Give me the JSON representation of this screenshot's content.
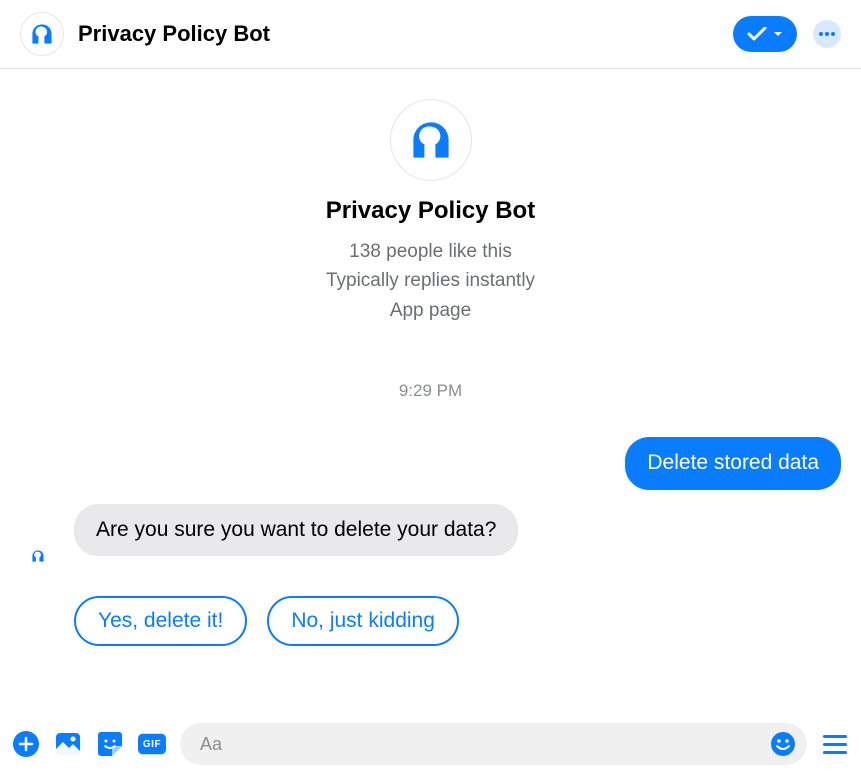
{
  "header": {
    "title": "Privacy Policy Bot"
  },
  "profile": {
    "name": "Privacy Policy Bot",
    "likes": "138 people like this",
    "replies": "Typically replies instantly",
    "page_type": "App page"
  },
  "timestamp": "9:29 PM",
  "messages": {
    "sent1": "Delete stored data",
    "received1": "Are you sure you want to delete your data?"
  },
  "quick_replies": {
    "yes": "Yes, delete it!",
    "no": "No, just kidding"
  },
  "composer": {
    "placeholder": "Aa",
    "gif_label": "GIF"
  }
}
